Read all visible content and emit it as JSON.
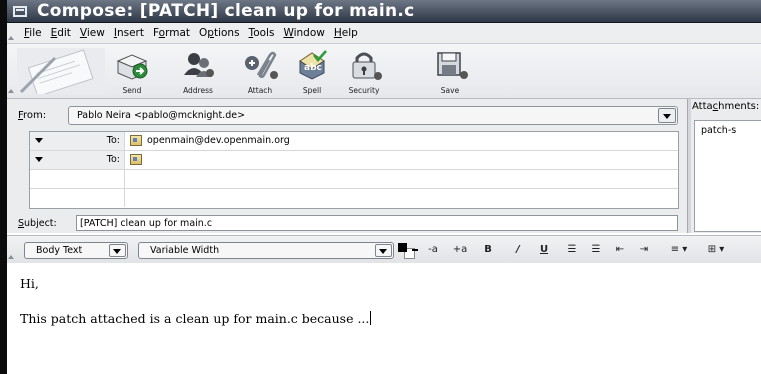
{
  "window": {
    "title": "Compose: [PATCH] clean up for main.c"
  },
  "menubar": {
    "items": [
      {
        "label": "File",
        "accel": "F"
      },
      {
        "label": "Edit",
        "accel": "E"
      },
      {
        "label": "View",
        "accel": "V"
      },
      {
        "label": "Insert",
        "accel": "I"
      },
      {
        "label": "Format",
        "accel": "o"
      },
      {
        "label": "Options",
        "accel": "p"
      },
      {
        "label": "Tools",
        "accel": "T"
      },
      {
        "label": "Window",
        "accel": "W"
      },
      {
        "label": "Help",
        "accel": "H"
      }
    ]
  },
  "toolbar": {
    "buttons": [
      {
        "label": "Send",
        "icon": "send-icon"
      },
      {
        "label": "Address",
        "icon": "address-book-icon"
      },
      {
        "label": "Attach",
        "icon": "paperclip-icon"
      },
      {
        "label": "Spell",
        "icon": "spell-check-icon"
      },
      {
        "label": "Security",
        "icon": "lock-icon"
      },
      {
        "label": "Save",
        "icon": "save-icon"
      }
    ]
  },
  "header": {
    "from_label": "From:",
    "from_value": "Pablo Neira <pablo@mcknight.de>",
    "recipients": [
      {
        "type": "To:",
        "value": "openmain@dev.openmain.org"
      },
      {
        "type": "To:",
        "value": ""
      }
    ],
    "subject_label": "Subject:",
    "subject_value": "[PATCH] clean up for main.c"
  },
  "attachments": {
    "label": "Attachments:",
    "items": [
      "patch-s"
    ]
  },
  "format_toolbar": {
    "paragraph_style": "Body Text",
    "font": "Variable Width",
    "text_color": "#000000",
    "background_color": "#ffffff",
    "buttons": [
      "-a",
      "+a",
      "B",
      "/",
      "U",
      "☰",
      "☰",
      "⇤",
      "⇥",
      "≡ ▾",
      "⊞ ▾"
    ]
  },
  "body": {
    "lines": [
      "Hi,",
      "This patch attached is a clean up for main.c because ..."
    ]
  }
}
